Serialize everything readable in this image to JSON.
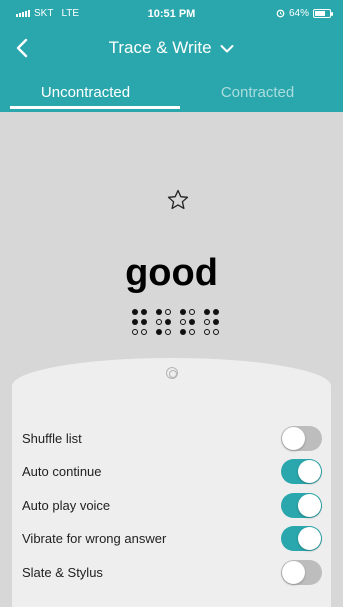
{
  "status_bar": {
    "carrier": "SKT",
    "network": "LTE",
    "time": "10:51 PM",
    "battery": "64%",
    "battery_level": 0.64
  },
  "header": {
    "title": "Trace & Write"
  },
  "tabs": [
    {
      "label": "Uncontracted",
      "active": true
    },
    {
      "label": "Contracted",
      "active": false
    }
  ],
  "card": {
    "word": "good"
  },
  "options": [
    {
      "label": "Shuffle list",
      "on": false
    },
    {
      "label": "Auto continue",
      "on": true
    },
    {
      "label": "Auto play voice",
      "on": true
    },
    {
      "label": "Vibrate for wrong answer",
      "on": true
    },
    {
      "label": "Slate & Stylus",
      "on": false
    }
  ],
  "colors": {
    "accent": "#2aa7ac",
    "card_bg": "#d7d7d7",
    "sheet_bg": "#eeeeee"
  }
}
